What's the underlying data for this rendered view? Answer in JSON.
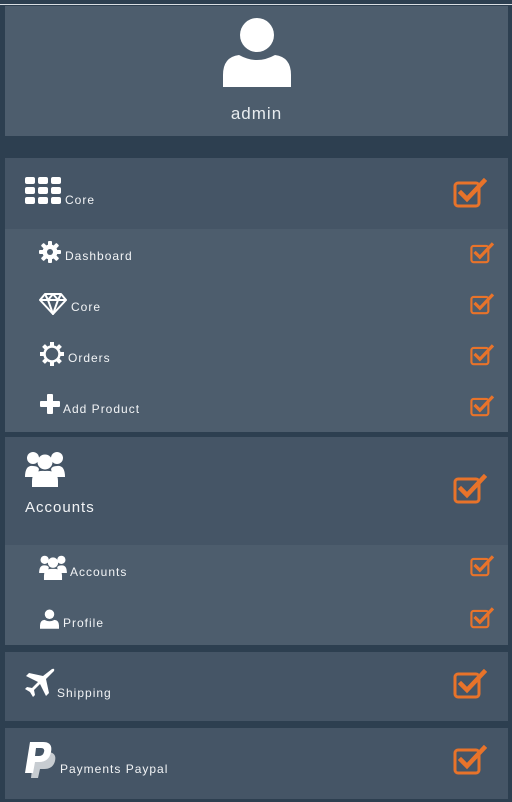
{
  "profile": {
    "username": "admin",
    "avatar_icon": "user-icon"
  },
  "accent_color": "#e8732a",
  "groups": [
    {
      "label": "Core",
      "icon": "grid-icon",
      "checked": true,
      "items": [
        {
          "label": "Dashboard",
          "icon": "gear-icon",
          "checked": true
        },
        {
          "label": "Core",
          "icon": "diamond-icon",
          "checked": true
        },
        {
          "label": "Orders",
          "icon": "sun-icon",
          "checked": true
        },
        {
          "label": "Add Product",
          "icon": "plus-icon",
          "checked": true
        }
      ]
    },
    {
      "label": "Accounts",
      "icon": "users-icon",
      "checked": true,
      "items": [
        {
          "label": "Accounts",
          "icon": "users-icon",
          "checked": true
        },
        {
          "label": "Profile",
          "icon": "user-icon",
          "checked": true
        }
      ]
    },
    {
      "label": "Shipping",
      "icon": "plane-icon",
      "checked": true,
      "items": []
    },
    {
      "label": "Payments Paypal",
      "icon": "paypal-icon",
      "checked": true,
      "items": []
    }
  ]
}
